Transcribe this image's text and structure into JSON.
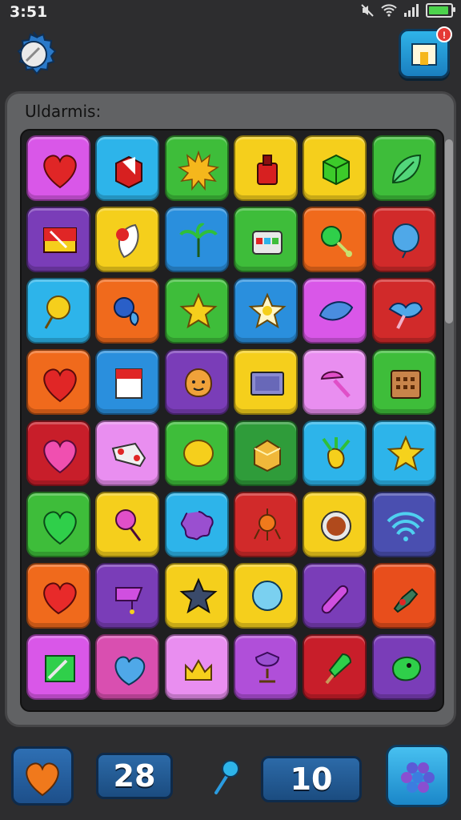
{
  "status": {
    "time": "3:51"
  },
  "header": {
    "notification_count": "!"
  },
  "board": {
    "title": "Uldarmis:",
    "rows": [
      [
        {
          "bg": "#d957e8",
          "icon": "heart-icon"
        },
        {
          "bg": "#2db4ea",
          "icon": "red-box-icon"
        },
        {
          "bg": "#3ebd3a",
          "icon": "sun-burst-icon"
        },
        {
          "bg": "#f5cf1c",
          "icon": "red-bottle-icon"
        },
        {
          "bg": "#f5cf1c",
          "icon": "green-cube-icon"
        },
        {
          "bg": "#3ebd3a",
          "icon": "leaf-icon"
        }
      ],
      [
        {
          "bg": "#7a3db8",
          "icon": "flag-icon"
        },
        {
          "bg": "#f5cf1c",
          "icon": "feather-icon"
        },
        {
          "bg": "#2a8fdd",
          "icon": "palm-icon"
        },
        {
          "bg": "#3ebd3a",
          "icon": "chest-icon"
        },
        {
          "bg": "#f06a1c",
          "icon": "green-lollipop-icon"
        },
        {
          "bg": "#d12a2a",
          "icon": "blue-balloon-icon"
        }
      ],
      [
        {
          "bg": "#2db4ea",
          "icon": "yellow-lollipop-icon"
        },
        {
          "bg": "#f06a1c",
          "icon": "blue-berry-icon"
        },
        {
          "bg": "#3ebd3a",
          "icon": "star-icon"
        },
        {
          "bg": "#2a8fdd",
          "icon": "white-star-icon"
        },
        {
          "bg": "#d957e8",
          "icon": "blue-leaf-icon"
        },
        {
          "bg": "#d12a2a",
          "icon": "blue-bird-icon"
        }
      ],
      [
        {
          "bg": "#f06a1c",
          "icon": "heart-icon"
        },
        {
          "bg": "#2a8fdd",
          "icon": "card-icon"
        },
        {
          "bg": "#7a3db8",
          "icon": "face-icon"
        },
        {
          "bg": "#f5cf1c",
          "icon": "screen-icon"
        },
        {
          "bg": "#e98ef0",
          "icon": "mushroom-icon"
        },
        {
          "bg": "#3ebd3a",
          "icon": "calendar-icon"
        }
      ],
      [
        {
          "bg": "#c81e2a",
          "icon": "pink-heart-icon"
        },
        {
          "bg": "#e98ef0",
          "icon": "gamepad-icon"
        },
        {
          "bg": "#3ebd3a",
          "icon": "yellow-bubble-icon"
        },
        {
          "bg": "#2f9c3a",
          "icon": "yellow-gem-icon"
        },
        {
          "bg": "#2db4ea",
          "icon": "pineapple-icon"
        },
        {
          "bg": "#2db4ea",
          "icon": "yellow-star-icon"
        }
      ],
      [
        {
          "bg": "#3ebd3a",
          "icon": "green-heart-icon"
        },
        {
          "bg": "#f5cf1c",
          "icon": "pink-lollipop-icon"
        },
        {
          "bg": "#2db4ea",
          "icon": "purple-flower-icon"
        },
        {
          "bg": "#d12a2a",
          "icon": "orange-spider-icon"
        },
        {
          "bg": "#f5cf1c",
          "icon": "donut-icon"
        },
        {
          "bg": "#4a4fb0",
          "icon": "wifi-icon"
        }
      ],
      [
        {
          "bg": "#f06a1c",
          "icon": "red-heart-icon"
        },
        {
          "bg": "#7a3db8",
          "icon": "purple-flag-icon"
        },
        {
          "bg": "#f5cf1c",
          "icon": "dark-star-icon"
        },
        {
          "bg": "#f5cf1c",
          "icon": "blue-orb-icon"
        },
        {
          "bg": "#7a3db8",
          "icon": "capsule-icon"
        },
        {
          "bg": "#e84e1c",
          "icon": "gem-chain-icon"
        }
      ],
      [
        {
          "bg": "#d957e8",
          "icon": "pencil-icon"
        },
        {
          "bg": "#d94fb0",
          "icon": "blue-heart-icon"
        },
        {
          "bg": "#e98ef0",
          "icon": "crown-icon"
        },
        {
          "bg": "#b04fd9",
          "icon": "goblet-icon"
        },
        {
          "bg": "#c81e2a",
          "icon": "popsicle-icon"
        },
        {
          "bg": "#7a3db8",
          "icon": "dragon-icon"
        }
      ]
    ]
  },
  "footer": {
    "score": "28",
    "moves": "10"
  }
}
